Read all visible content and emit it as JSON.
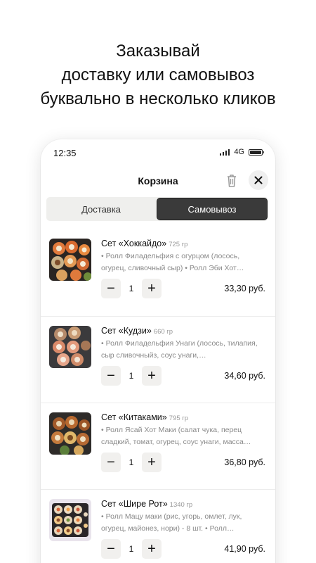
{
  "promo": {
    "line1": "Заказывай",
    "line2": "доставку или самовывоз",
    "line3": "буквально в несколько кликов"
  },
  "status_bar": {
    "time": "12:35",
    "network": "4G"
  },
  "header": {
    "title": "Корзина",
    "trash_icon": "trash-icon",
    "close_icon": "close-icon"
  },
  "tabs": [
    {
      "label": "Доставка",
      "active": false
    },
    {
      "label": "Самовывоз",
      "active": true
    }
  ],
  "cart": {
    "items": [
      {
        "name": "Сет «Хоккайдо»",
        "weight": "725 гр",
        "description": "• Ролл Филадельфия с огурцом (лосось, огурец, сливочный сыр) • Ролл Эби Хот…",
        "quantity": "1",
        "price": "33,30 руб."
      },
      {
        "name": "Сет «Кудзи»",
        "weight": "660 гр",
        "description": "• Ролл Филадельфия Унаги (лосось, тилапия, сыр сливочныйз, соус унаги,…",
        "quantity": "1",
        "price": "34,60 руб."
      },
      {
        "name": "Сет «Китаками»",
        "weight": "795 гр",
        "description": "• Ролл Ясай Хот Маки (салат чука, перец сладкий, томат, огурец, соус унаги, масса…",
        "quantity": "1",
        "price": "36,80 руб."
      },
      {
        "name": "Сет «Шире Рот»",
        "weight": "1340 гр",
        "description": "• Ролл Мацу маки (рис, угорь, омлет, лук, огурец, майонез, нори) - 8 шт. • Ролл…",
        "quantity": "1",
        "price": "41,90 руб."
      }
    ],
    "minus_symbol": "−",
    "plus_symbol": "+"
  }
}
